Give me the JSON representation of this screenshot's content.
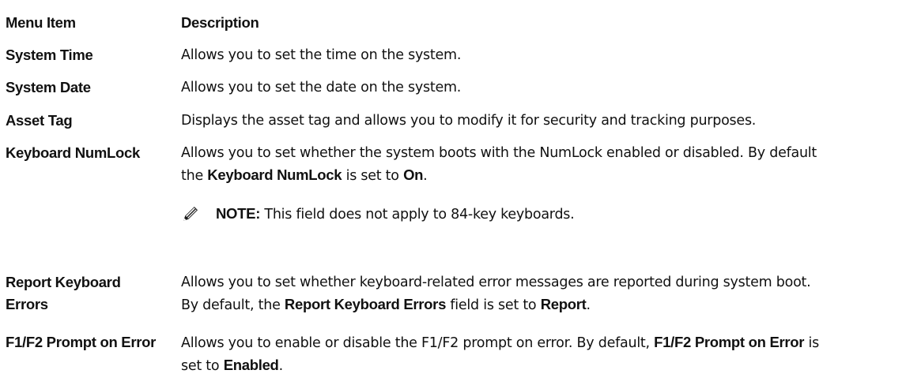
{
  "header": {
    "menu_item": "Menu Item",
    "description": "Description"
  },
  "rows": [
    {
      "term": "System Time",
      "desc": "Allows you to set the time on the system."
    },
    {
      "term": "System Date",
      "desc": "Allows you to set the date on the system."
    },
    {
      "term": "Asset Tag",
      "desc": "Displays the asset tag and allows you to modify it for security and tracking purposes."
    },
    {
      "term": "Keyboard NumLock",
      "desc_1": "Allows you to set whether the system boots with the NumLock enabled or disabled. By default",
      "desc_2a": "the ",
      "desc_2b": "Keyboard NumLock",
      "desc_2c": " is set to ",
      "desc_2d": "On",
      "desc_2e": ".",
      "note_label": "NOTE:",
      "note_text": " This field does not apply to 84-key keyboards."
    },
    {
      "term_1": "Report Keyboard",
      "term_2": "Errors",
      "desc_1": "Allows you to set whether keyboard-related error messages are reported during system boot.",
      "desc_2a": "By default, the ",
      "desc_2b": "Report Keyboard Errors",
      "desc_2c": " field is set to ",
      "desc_2d": "Report",
      "desc_2e": "."
    },
    {
      "term": "F1/F2 Prompt on Error",
      "desc_1a": "Allows you to enable or disable the F1/F2 prompt on error. By default, ",
      "desc_1b": "F1/F2 Prompt on Error",
      "desc_1c": " is",
      "desc_2a": "set to ",
      "desc_2b": "Enabled",
      "desc_2c": "."
    }
  ],
  "icons": {
    "note": "pencil-note-icon"
  }
}
